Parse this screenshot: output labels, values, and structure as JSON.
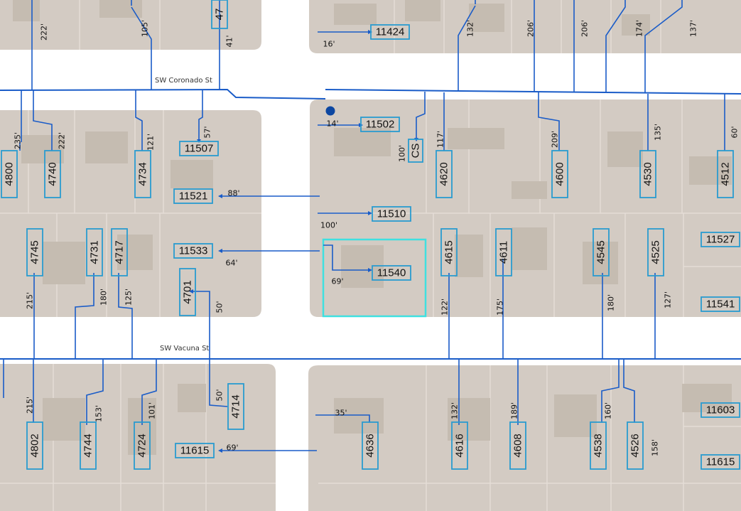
{
  "map": {
    "streets": [
      {
        "name": "SW Coronado St"
      },
      {
        "name": "SW Vacuna St"
      }
    ],
    "colors": {
      "lot": "#d3cbc3",
      "road": "#ffffff",
      "service_line": "#1a5cc8",
      "label_border": "#2a9bd0",
      "selected_parcel": "#3fe0e0",
      "marker": "#0d47a1"
    },
    "address_labels": [
      {
        "id": "a4800",
        "text": "4800"
      },
      {
        "id": "a4740",
        "text": "4740"
      },
      {
        "id": "a4734",
        "text": "4734"
      },
      {
        "id": "a11507",
        "text": "11507"
      },
      {
        "id": "a11521",
        "text": "11521"
      },
      {
        "id": "a11533",
        "text": "11533"
      },
      {
        "id": "a4745",
        "text": "4745"
      },
      {
        "id": "a4731",
        "text": "4731"
      },
      {
        "id": "a4717",
        "text": "4717"
      },
      {
        "id": "a4701",
        "text": "4701"
      },
      {
        "id": "a11424",
        "text": "11424"
      },
      {
        "id": "a11502",
        "text": "11502"
      },
      {
        "id": "aCS",
        "text": "CS"
      },
      {
        "id": "a4620",
        "text": "4620"
      },
      {
        "id": "a4600",
        "text": "4600"
      },
      {
        "id": "a4530",
        "text": "4530"
      },
      {
        "id": "a4512",
        "text": "4512"
      },
      {
        "id": "a11510",
        "text": "11510"
      },
      {
        "id": "a11540",
        "text": "11540"
      },
      {
        "id": "a4615",
        "text": "4615"
      },
      {
        "id": "a4611",
        "text": "4611"
      },
      {
        "id": "a4545",
        "text": "4545"
      },
      {
        "id": "a4525",
        "text": "4525"
      },
      {
        "id": "a11527",
        "text": "11527"
      },
      {
        "id": "a11541",
        "text": "11541"
      },
      {
        "id": "a4802",
        "text": "4802"
      },
      {
        "id": "a4744",
        "text": "4744"
      },
      {
        "id": "a4724",
        "text": "4724"
      },
      {
        "id": "a4714",
        "text": "4714"
      },
      {
        "id": "a11615w",
        "text": "11615"
      },
      {
        "id": "a4636",
        "text": "4636"
      },
      {
        "id": "a4616",
        "text": "4616"
      },
      {
        "id": "a4608",
        "text": "4608"
      },
      {
        "id": "a4538",
        "text": "4538"
      },
      {
        "id": "a4526",
        "text": "4526"
      },
      {
        "id": "a11603",
        "text": "11603"
      },
      {
        "id": "a11615e",
        "text": "11615"
      },
      {
        "id": "a47top",
        "text": "47"
      }
    ],
    "length_labels": [
      {
        "id": "l222a",
        "text": "222'"
      },
      {
        "id": "l105",
        "text": "105'"
      },
      {
        "id": "l41",
        "text": "41'"
      },
      {
        "id": "l16",
        "text": "16'"
      },
      {
        "id": "l132a",
        "text": "132'"
      },
      {
        "id": "l206a",
        "text": "206'"
      },
      {
        "id": "l206b",
        "text": "206'"
      },
      {
        "id": "l174",
        "text": "174'"
      },
      {
        "id": "l137",
        "text": "137'"
      },
      {
        "id": "l235",
        "text": "235'"
      },
      {
        "id": "l222b",
        "text": "222'"
      },
      {
        "id": "l121",
        "text": "121'"
      },
      {
        "id": "l57",
        "text": "57'"
      },
      {
        "id": "l14",
        "text": "14'"
      },
      {
        "id": "l100a",
        "text": "100'"
      },
      {
        "id": "l117",
        "text": "117'"
      },
      {
        "id": "l209",
        "text": "209'"
      },
      {
        "id": "l135",
        "text": "135'"
      },
      {
        "id": "l60",
        "text": "60'"
      },
      {
        "id": "l88",
        "text": "88'"
      },
      {
        "id": "l100b",
        "text": "100'"
      },
      {
        "id": "l64",
        "text": "64'"
      },
      {
        "id": "l69a",
        "text": "69'"
      },
      {
        "id": "l215a",
        "text": "215'"
      },
      {
        "id": "l180a",
        "text": "180'"
      },
      {
        "id": "l125",
        "text": "125'"
      },
      {
        "id": "l50a",
        "text": "50'"
      },
      {
        "id": "l122",
        "text": "122'"
      },
      {
        "id": "l175",
        "text": "175'"
      },
      {
        "id": "l180b",
        "text": "180'"
      },
      {
        "id": "l127",
        "text": "127'"
      },
      {
        "id": "l215b",
        "text": "215'"
      },
      {
        "id": "l153",
        "text": "153'"
      },
      {
        "id": "l101",
        "text": "101'"
      },
      {
        "id": "l50b",
        "text": "50'"
      },
      {
        "id": "l35",
        "text": "35'"
      },
      {
        "id": "l132b",
        "text": "132'"
      },
      {
        "id": "l189",
        "text": "189'"
      },
      {
        "id": "l160",
        "text": "160'"
      },
      {
        "id": "l158",
        "text": "158'"
      },
      {
        "id": "l69b",
        "text": "69'"
      }
    ]
  }
}
